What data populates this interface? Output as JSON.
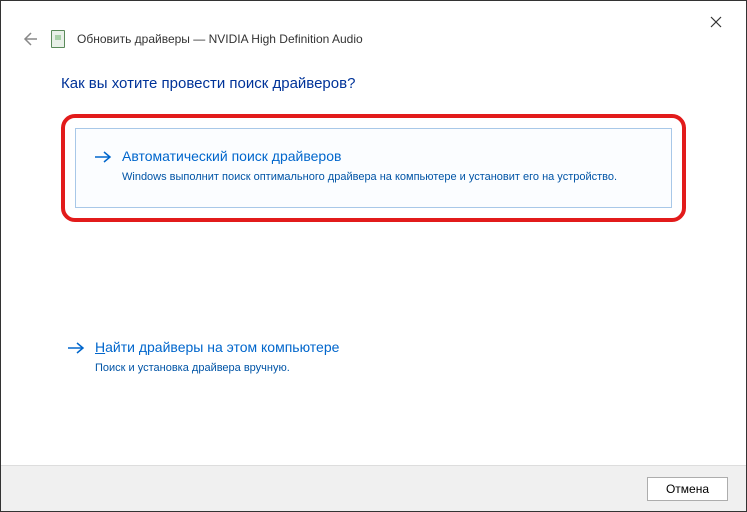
{
  "window": {
    "title": "Обновить драйверы — NVIDIA High Definition Audio"
  },
  "question": "Как вы хотите провести поиск драйверов?",
  "option1": {
    "title": "Автоматический поиск драйверов",
    "desc": "Windows выполнит поиск оптимального драйвера на компьютере и установит его на устройство."
  },
  "option2": {
    "accel": "Н",
    "title_rest": "айти драйверы на этом компьютере",
    "desc": "Поиск и установка драйвера вручную."
  },
  "footer": {
    "cancel": "Отмена"
  },
  "colors": {
    "accent": "#0066cc",
    "highlight": "#e21b1b"
  }
}
